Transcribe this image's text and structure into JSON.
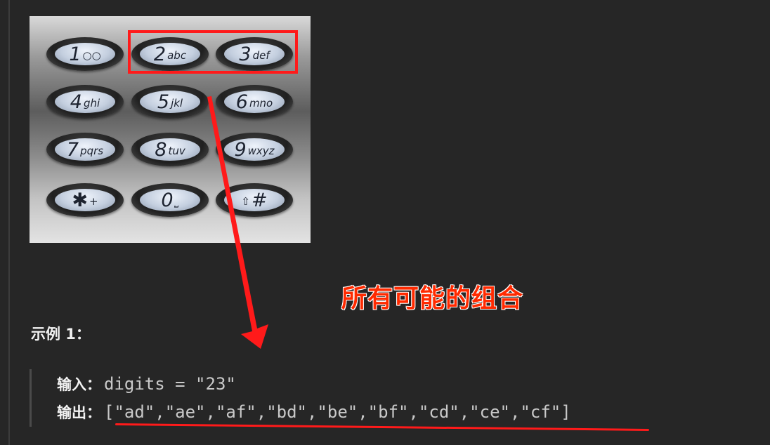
{
  "keypad": {
    "keys": [
      {
        "digit": "1",
        "letters": "○○"
      },
      {
        "digit": "2",
        "letters": "abc"
      },
      {
        "digit": "3",
        "letters": "def"
      },
      {
        "digit": "4",
        "letters": "ghi"
      },
      {
        "digit": "5",
        "letters": "jkl"
      },
      {
        "digit": "6",
        "letters": "mno"
      },
      {
        "digit": "7",
        "letters": "pqrs"
      },
      {
        "digit": "8",
        "letters": "tuv"
      },
      {
        "digit": "9",
        "letters": "wxyz"
      },
      {
        "digit": "✱",
        "letters": "+"
      },
      {
        "digit": "0",
        "letters": "⎵"
      },
      {
        "digit": "⇧",
        "letters": "#"
      }
    ]
  },
  "annotation": {
    "text": "所有可能的组合",
    "color": "#ff2a00"
  },
  "example": {
    "heading": "示例 1：",
    "input_label": "输入：",
    "input_value": "digits = \"23\"",
    "output_label": "输出：",
    "output_value": "[\"ad\",\"ae\",\"af\",\"bd\",\"be\",\"bf\",\"cd\",\"ce\",\"cf\"]"
  },
  "colors": {
    "background": "#262626",
    "highlight": "#ff1a1a",
    "text": "#f2f2f2",
    "code": "#c9c9c9"
  }
}
